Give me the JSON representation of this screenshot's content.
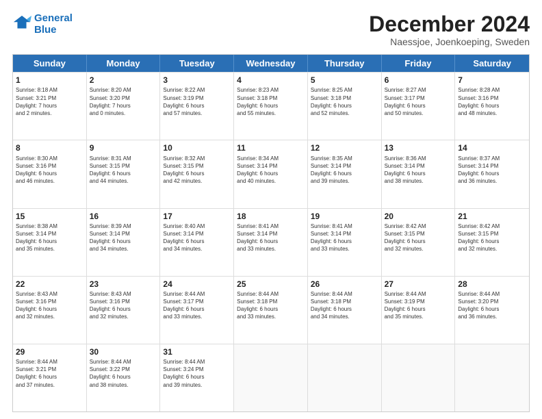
{
  "logo": {
    "line1": "General",
    "line2": "Blue"
  },
  "calendar": {
    "title": "December 2024",
    "subtitle": "Naessjoe, Joenkoeping, Sweden",
    "headers": [
      "Sunday",
      "Monday",
      "Tuesday",
      "Wednesday",
      "Thursday",
      "Friday",
      "Saturday"
    ],
    "rows": [
      [
        {
          "day": "",
          "content": ""
        },
        {
          "day": "1",
          "content": "Sunrise: 8:18 AM\nSunset: 3:21 PM\nDaylight: 7 hours\nand 2 minutes."
        },
        {
          "day": "2",
          "content": "Sunrise: 8:20 AM\nSunset: 3:20 PM\nDaylight: 7 hours\nand 0 minutes."
        },
        {
          "day": "3",
          "content": "Sunrise: 8:22 AM\nSunset: 3:19 PM\nDaylight: 6 hours\nand 57 minutes."
        },
        {
          "day": "4",
          "content": "Sunrise: 8:23 AM\nSunset: 3:18 PM\nDaylight: 6 hours\nand 55 minutes."
        },
        {
          "day": "5",
          "content": "Sunrise: 8:25 AM\nSunset: 3:18 PM\nDaylight: 6 hours\nand 52 minutes."
        },
        {
          "day": "6",
          "content": "Sunrise: 8:27 AM\nSunset: 3:17 PM\nDaylight: 6 hours\nand 50 minutes."
        },
        {
          "day": "7",
          "content": "Sunrise: 8:28 AM\nSunset: 3:16 PM\nDaylight: 6 hours\nand 48 minutes."
        }
      ],
      [
        {
          "day": "8",
          "content": "Sunrise: 8:30 AM\nSunset: 3:16 PM\nDaylight: 6 hours\nand 46 minutes."
        },
        {
          "day": "9",
          "content": "Sunrise: 8:31 AM\nSunset: 3:15 PM\nDaylight: 6 hours\nand 44 minutes."
        },
        {
          "day": "10",
          "content": "Sunrise: 8:32 AM\nSunset: 3:15 PM\nDaylight: 6 hours\nand 42 minutes."
        },
        {
          "day": "11",
          "content": "Sunrise: 8:34 AM\nSunset: 3:14 PM\nDaylight: 6 hours\nand 40 minutes."
        },
        {
          "day": "12",
          "content": "Sunrise: 8:35 AM\nSunset: 3:14 PM\nDaylight: 6 hours\nand 39 minutes."
        },
        {
          "day": "13",
          "content": "Sunrise: 8:36 AM\nSunset: 3:14 PM\nDaylight: 6 hours\nand 38 minutes."
        },
        {
          "day": "14",
          "content": "Sunrise: 8:37 AM\nSunset: 3:14 PM\nDaylight: 6 hours\nand 36 minutes."
        }
      ],
      [
        {
          "day": "15",
          "content": "Sunrise: 8:38 AM\nSunset: 3:14 PM\nDaylight: 6 hours\nand 35 minutes."
        },
        {
          "day": "16",
          "content": "Sunrise: 8:39 AM\nSunset: 3:14 PM\nDaylight: 6 hours\nand 34 minutes."
        },
        {
          "day": "17",
          "content": "Sunrise: 8:40 AM\nSunset: 3:14 PM\nDaylight: 6 hours\nand 34 minutes."
        },
        {
          "day": "18",
          "content": "Sunrise: 8:41 AM\nSunset: 3:14 PM\nDaylight: 6 hours\nand 33 minutes."
        },
        {
          "day": "19",
          "content": "Sunrise: 8:41 AM\nSunset: 3:14 PM\nDaylight: 6 hours\nand 33 minutes."
        },
        {
          "day": "20",
          "content": "Sunrise: 8:42 AM\nSunset: 3:15 PM\nDaylight: 6 hours\nand 32 minutes."
        },
        {
          "day": "21",
          "content": "Sunrise: 8:42 AM\nSunset: 3:15 PM\nDaylight: 6 hours\nand 32 minutes."
        }
      ],
      [
        {
          "day": "22",
          "content": "Sunrise: 8:43 AM\nSunset: 3:16 PM\nDaylight: 6 hours\nand 32 minutes."
        },
        {
          "day": "23",
          "content": "Sunrise: 8:43 AM\nSunset: 3:16 PM\nDaylight: 6 hours\nand 32 minutes."
        },
        {
          "day": "24",
          "content": "Sunrise: 8:44 AM\nSunset: 3:17 PM\nDaylight: 6 hours\nand 33 minutes."
        },
        {
          "day": "25",
          "content": "Sunrise: 8:44 AM\nSunset: 3:18 PM\nDaylight: 6 hours\nand 33 minutes."
        },
        {
          "day": "26",
          "content": "Sunrise: 8:44 AM\nSunset: 3:18 PM\nDaylight: 6 hours\nand 34 minutes."
        },
        {
          "day": "27",
          "content": "Sunrise: 8:44 AM\nSunset: 3:19 PM\nDaylight: 6 hours\nand 35 minutes."
        },
        {
          "day": "28",
          "content": "Sunrise: 8:44 AM\nSunset: 3:20 PM\nDaylight: 6 hours\nand 36 minutes."
        }
      ],
      [
        {
          "day": "29",
          "content": "Sunrise: 8:44 AM\nSunset: 3:21 PM\nDaylight: 6 hours\nand 37 minutes."
        },
        {
          "day": "30",
          "content": "Sunrise: 8:44 AM\nSunset: 3:22 PM\nDaylight: 6 hours\nand 38 minutes."
        },
        {
          "day": "31",
          "content": "Sunrise: 8:44 AM\nSunset: 3:24 PM\nDaylight: 6 hours\nand 39 minutes."
        },
        {
          "day": "",
          "content": ""
        },
        {
          "day": "",
          "content": ""
        },
        {
          "day": "",
          "content": ""
        },
        {
          "day": "",
          "content": ""
        }
      ]
    ]
  }
}
